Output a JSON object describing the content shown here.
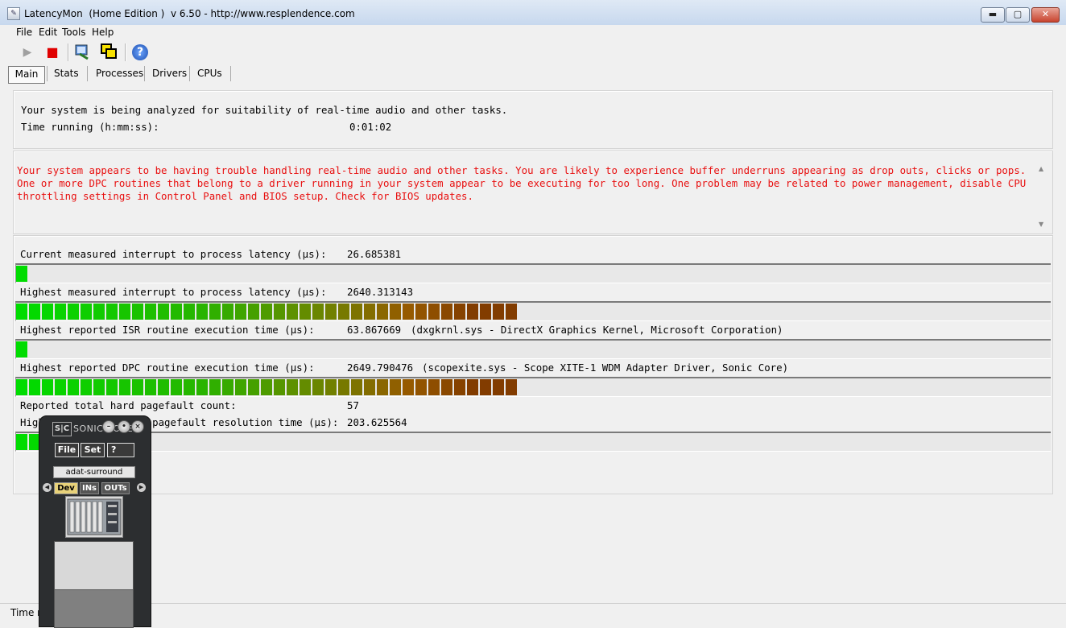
{
  "window": {
    "title": "LatencyMon  (Home Edition )  v 6.50 - http://www.resplendence.com",
    "minimize": "▬",
    "maximize": "▢",
    "close": "✕"
  },
  "menu": [
    "File",
    "Edit",
    "Tools",
    "Help"
  ],
  "toolbar": {
    "play_icon": "▶",
    "stop_icon": "■",
    "help_icon": "?"
  },
  "tabs": [
    "Main",
    "Stats",
    "Processes",
    "Drivers",
    "CPUs"
  ],
  "summary": {
    "line1": "Your system is being analyzed for suitability of real-time audio and other tasks.",
    "time_label": "Time running (h:mm:ss):",
    "time_value": "0:01:02"
  },
  "warning": {
    "text": "Your system appears to be having trouble handling real-time audio and other tasks. You are likely to experience buffer underruns appearing as drop outs, clicks or pops. One or more DPC routines that belong to a driver running in your system appear to be executing for too long. One problem may be related to power management, disable CPU throttling settings in Control Panel and BIOS setup. Check for BIOS updates."
  },
  "metrics": [
    {
      "label": "Current measured interrupt to process latency (µs):",
      "value": "26.685381",
      "detail": "",
      "bar_fraction": 0.0125
    },
    {
      "label": "Highest measured interrupt to process latency (µs):",
      "value": "2640.313143",
      "detail": "",
      "bar_fraction": 0.49
    },
    {
      "label": "Highest reported ISR routine execution time (µs):",
      "value": "63.867669",
      "detail": "(dxgkrnl.sys - DirectX Graphics Kernel, Microsoft Corporation)",
      "bar_fraction": 0.0125
    },
    {
      "label": "Highest reported DPC routine execution time (µs):",
      "value": "2649.790476",
      "detail": "(scopexite.sys - Scope XITE-1 WDM Adapter Driver, Sonic Core)",
      "bar_fraction": 0.49
    },
    {
      "label": "Reported total hard pagefault count:",
      "value": "57",
      "detail": "",
      "bar_fraction": null
    },
    {
      "label": "Highest reported hard pagefault resolution time (µs):",
      "value": "203.625564",
      "detail": "",
      "bar_fraction": 0.04
    }
  ],
  "statusbar": {
    "text": "Time r"
  },
  "sonic_core": {
    "logo": "S|C",
    "brand": "SONIC CORE",
    "file": "File",
    "set": "Set",
    "help": "?",
    "preset": "adat-surround",
    "tabs": [
      "Dev",
      "INs",
      "OUTs"
    ]
  }
}
